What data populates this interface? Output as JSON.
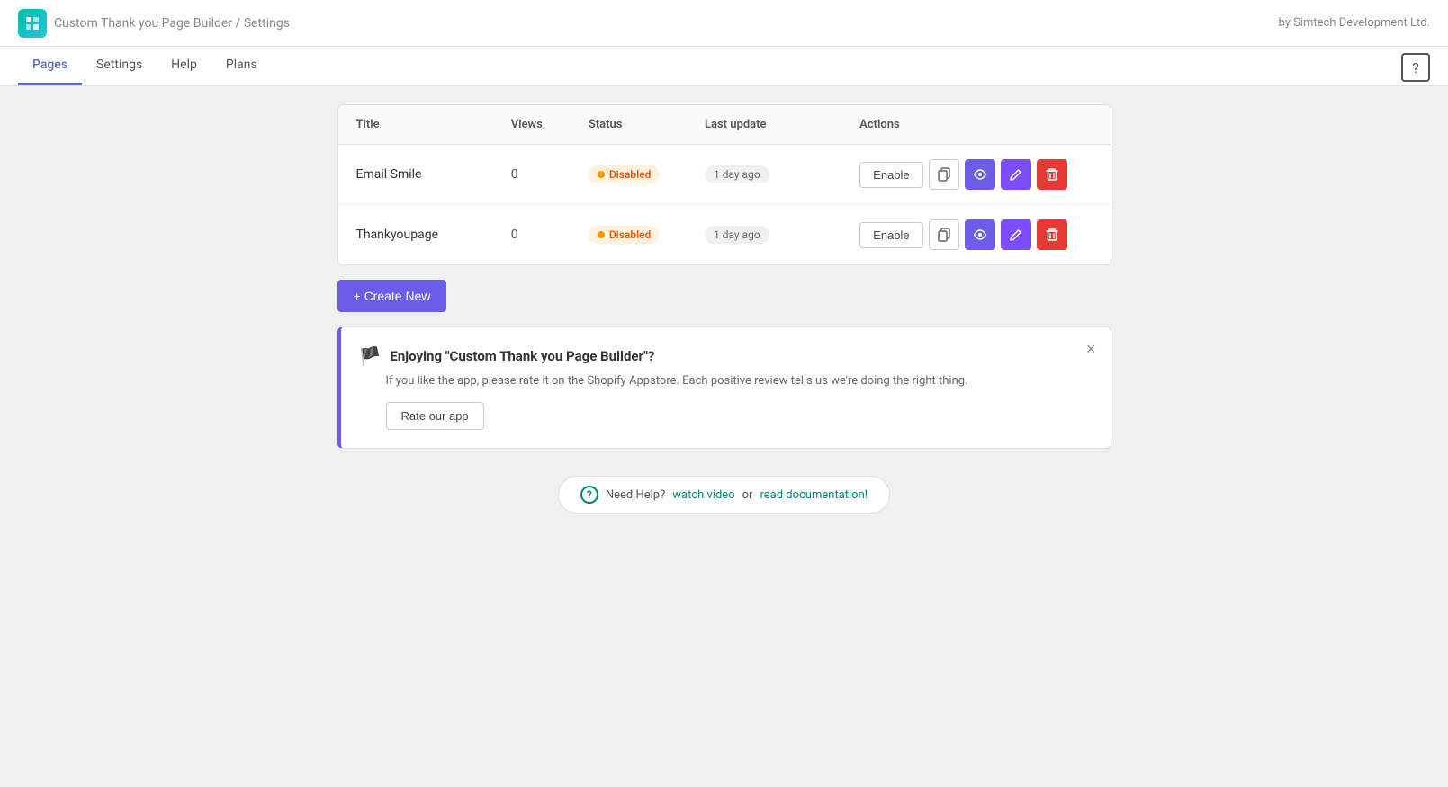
{
  "topbar": {
    "app_title": "Custom Thank you Page Builder",
    "separator": " / ",
    "page_name": "Settings",
    "by_label": "by Simtech Development Ltd."
  },
  "nav": {
    "tabs": [
      {
        "id": "pages",
        "label": "Pages",
        "active": true
      },
      {
        "id": "settings",
        "label": "Settings",
        "active": false
      },
      {
        "id": "help",
        "label": "Help",
        "active": false
      },
      {
        "id": "plans",
        "label": "Plans",
        "active": false
      }
    ],
    "help_icon": "?"
  },
  "table": {
    "headers": {
      "title": "Title",
      "views": "Views",
      "status": "Status",
      "last_update": "Last update",
      "actions": "Actions"
    },
    "rows": [
      {
        "title": "Email Smile",
        "views": "0",
        "status": "Disabled",
        "last_update": "1 day ago",
        "enable_label": "Enable"
      },
      {
        "title": "Thankyoupage",
        "views": "0",
        "status": "Disabled",
        "last_update": "1 day ago",
        "enable_label": "Enable"
      }
    ]
  },
  "create_new_btn": "+ Create New",
  "notification": {
    "title": "Enjoying \"Custom Thank you Page Builder\"?",
    "text": "If you like the app, please rate it on the Shopify Appstore. Each positive review tells us we're doing the right thing.",
    "rate_label": "Rate our app"
  },
  "help_footer": {
    "text": "Need Help?",
    "watch_label": "watch video",
    "or_label": "or",
    "docs_label": "read documentation!"
  },
  "colors": {
    "accent": "#6c5ce7",
    "danger": "#e53935",
    "teal": "#00897b"
  }
}
